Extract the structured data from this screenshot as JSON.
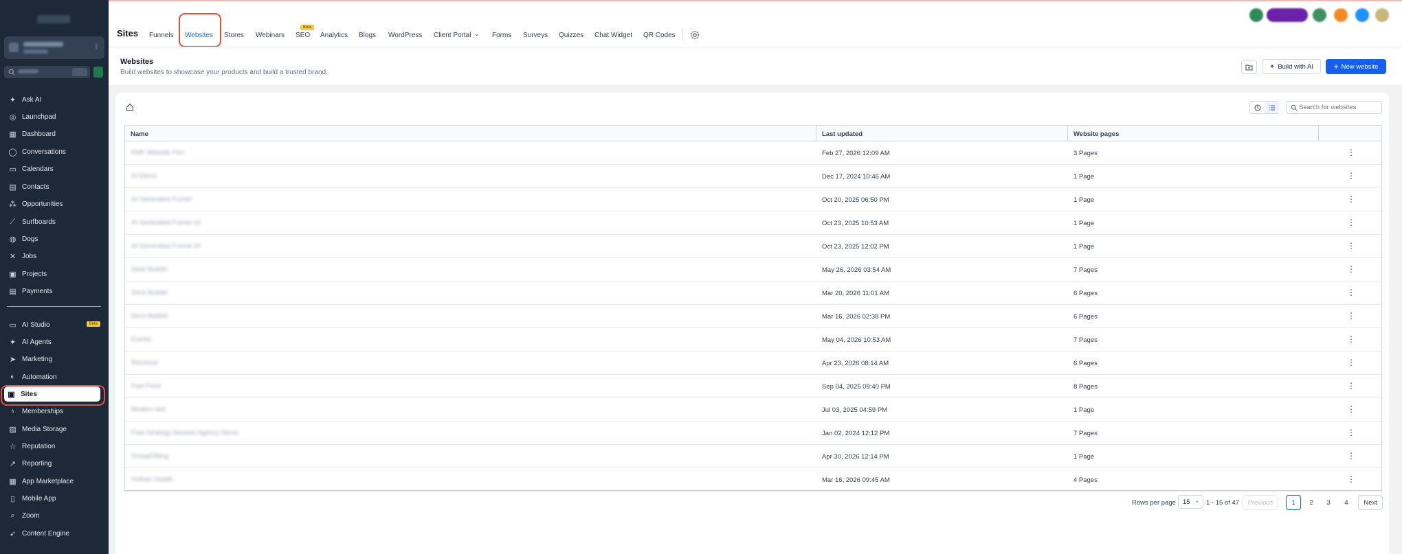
{
  "sidebar": {
    "items": [
      {
        "label": "Ask AI",
        "icon": "sparkle-icon",
        "glyph": "✦"
      },
      {
        "label": "Launchpad",
        "icon": "rocket-icon",
        "glyph": "◎"
      },
      {
        "label": "Dashboard",
        "icon": "dashboard-icon",
        "glyph": "▦"
      },
      {
        "label": "Conversations",
        "icon": "chat-icon",
        "glyph": "◯"
      },
      {
        "label": "Calendars",
        "icon": "calendar-icon",
        "glyph": "▭"
      },
      {
        "label": "Contacts",
        "icon": "contacts-icon",
        "glyph": "▤"
      },
      {
        "label": "Opportunities",
        "icon": "opportunities-icon",
        "glyph": "⁂"
      },
      {
        "label": "Surfboards",
        "icon": "surfboard-icon",
        "glyph": "⟋"
      },
      {
        "label": "Dogs",
        "icon": "dog-icon",
        "glyph": "◍"
      },
      {
        "label": "Jobs",
        "icon": "tools-icon",
        "glyph": "✕"
      },
      {
        "label": "Projects",
        "icon": "projects-icon",
        "glyph": "▣"
      },
      {
        "label": "Payments",
        "icon": "payments-icon",
        "glyph": "▤"
      },
      {
        "label": "AI Studio",
        "icon": "ai-studio-icon",
        "glyph": "▭",
        "badge": "Beta"
      },
      {
        "label": "AI Agents",
        "icon": "ai-agents-icon",
        "glyph": "✦"
      },
      {
        "label": "Marketing",
        "icon": "send-icon",
        "glyph": "➤"
      },
      {
        "label": "Automation",
        "icon": "automation-icon",
        "glyph": "◐"
      },
      {
        "label": "Sites",
        "icon": "globe-icon",
        "glyph": "▣"
      },
      {
        "label": "Memberships",
        "icon": "memberships-icon",
        "glyph": "♁"
      },
      {
        "label": "Media Storage",
        "icon": "image-icon",
        "glyph": "▨"
      },
      {
        "label": "Reputation",
        "icon": "star-icon",
        "glyph": "☆"
      },
      {
        "label": "Reporting",
        "icon": "trend-icon",
        "glyph": "↗"
      },
      {
        "label": "App Marketplace",
        "icon": "apps-icon",
        "glyph": "▦"
      },
      {
        "label": "Mobile App",
        "icon": "mobile-icon",
        "glyph": "▯"
      },
      {
        "label": "Zoom",
        "icon": "search-icon",
        "glyph": "⌕"
      },
      {
        "label": "Content Engine",
        "icon": "rocket-icon",
        "glyph": "➶"
      }
    ]
  },
  "topbar": {
    "section_title": "Sites",
    "tabs": [
      "Funnels",
      "Websites",
      "Stores",
      "Webinars",
      "SEO",
      "Analytics",
      "Blogs",
      "WordPress",
      "Client Portal",
      "Forms",
      "Surveys",
      "Quizzes",
      "Chat Widget",
      "QR Codes"
    ],
    "seo_badge": "Beta",
    "active_tab": "Websites"
  },
  "header": {
    "title": "Websites",
    "subtitle": "Build websites to showcase your products and build a trusted brand.",
    "build_ai_label": "Build with AI",
    "new_website_label": "New website"
  },
  "search": {
    "placeholder": "Search for websites"
  },
  "table": {
    "columns": [
      "Name",
      "Last updated",
      "Website pages"
    ],
    "rows": [
      {
        "name": "KMF Website Film",
        "updated": "Feb 27, 2026 12:09 AM",
        "pages": "3 Pages"
      },
      {
        "name": "AI Demo",
        "updated": "Dec 17, 2024 10:46 AM",
        "pages": "1 Page"
      },
      {
        "name": "AI Generated Funnel",
        "updated": "Oct 20, 2025 06:50 PM",
        "pages": "1 Page"
      },
      {
        "name": "AI Generated Funnel 10",
        "updated": "Oct 23, 2025 10:53 AM",
        "pages": "1 Page"
      },
      {
        "name": "AI Generated Funnel 10",
        "updated": "Oct 23, 2025 12:02 PM",
        "pages": "1 Page"
      },
      {
        "name": "Deck Builder",
        "updated": "May 26, 2026 03:54 AM",
        "pages": "7 Pages"
      },
      {
        "name": "Deck Builder",
        "updated": "Mar 20, 2026 11:01 AM",
        "pages": "6 Pages"
      },
      {
        "name": "Deck Builder",
        "updated": "Mar 16, 2026 02:38 PM",
        "pages": "6 Pages"
      },
      {
        "name": "Events",
        "updated": "May 04, 2026 10:53 AM",
        "pages": "7 Pages"
      },
      {
        "name": "Electrical",
        "updated": "Apr 23, 2026 08:14 AM",
        "pages": "6 Pages"
      },
      {
        "name": "Fast Food",
        "updated": "Sep 04, 2025 09:40 PM",
        "pages": "8 Pages"
      },
      {
        "name": "Modern test",
        "updated": "Jul 03, 2025 04:59 PM",
        "pages": "1 Page"
      },
      {
        "name": "Free Strategy Session Agency Demo",
        "updated": "Jan 02, 2024 12:12 PM",
        "pages": "7 Pages"
      },
      {
        "name": "GroupGifting",
        "updated": "Apr 30, 2026 12:14 PM",
        "pages": "1 Page"
      },
      {
        "name": "Holistic Health",
        "updated": "Mar 16, 2026 09:45 AM",
        "pages": "4 Pages"
      }
    ]
  },
  "pagination": {
    "rows_per_page_label": "Rows per page",
    "rows_per_page": "15",
    "range": "1 - 15 of 47",
    "previous": "Previous",
    "pages": [
      "1",
      "2",
      "3",
      "4"
    ],
    "current_page": "1",
    "next": "Next"
  },
  "colors": {
    "accent": "#155eef",
    "sidebar_bg": "#1d2939",
    "highlight_ring": "#e0533b",
    "beta_badge": "#f5c84c"
  }
}
